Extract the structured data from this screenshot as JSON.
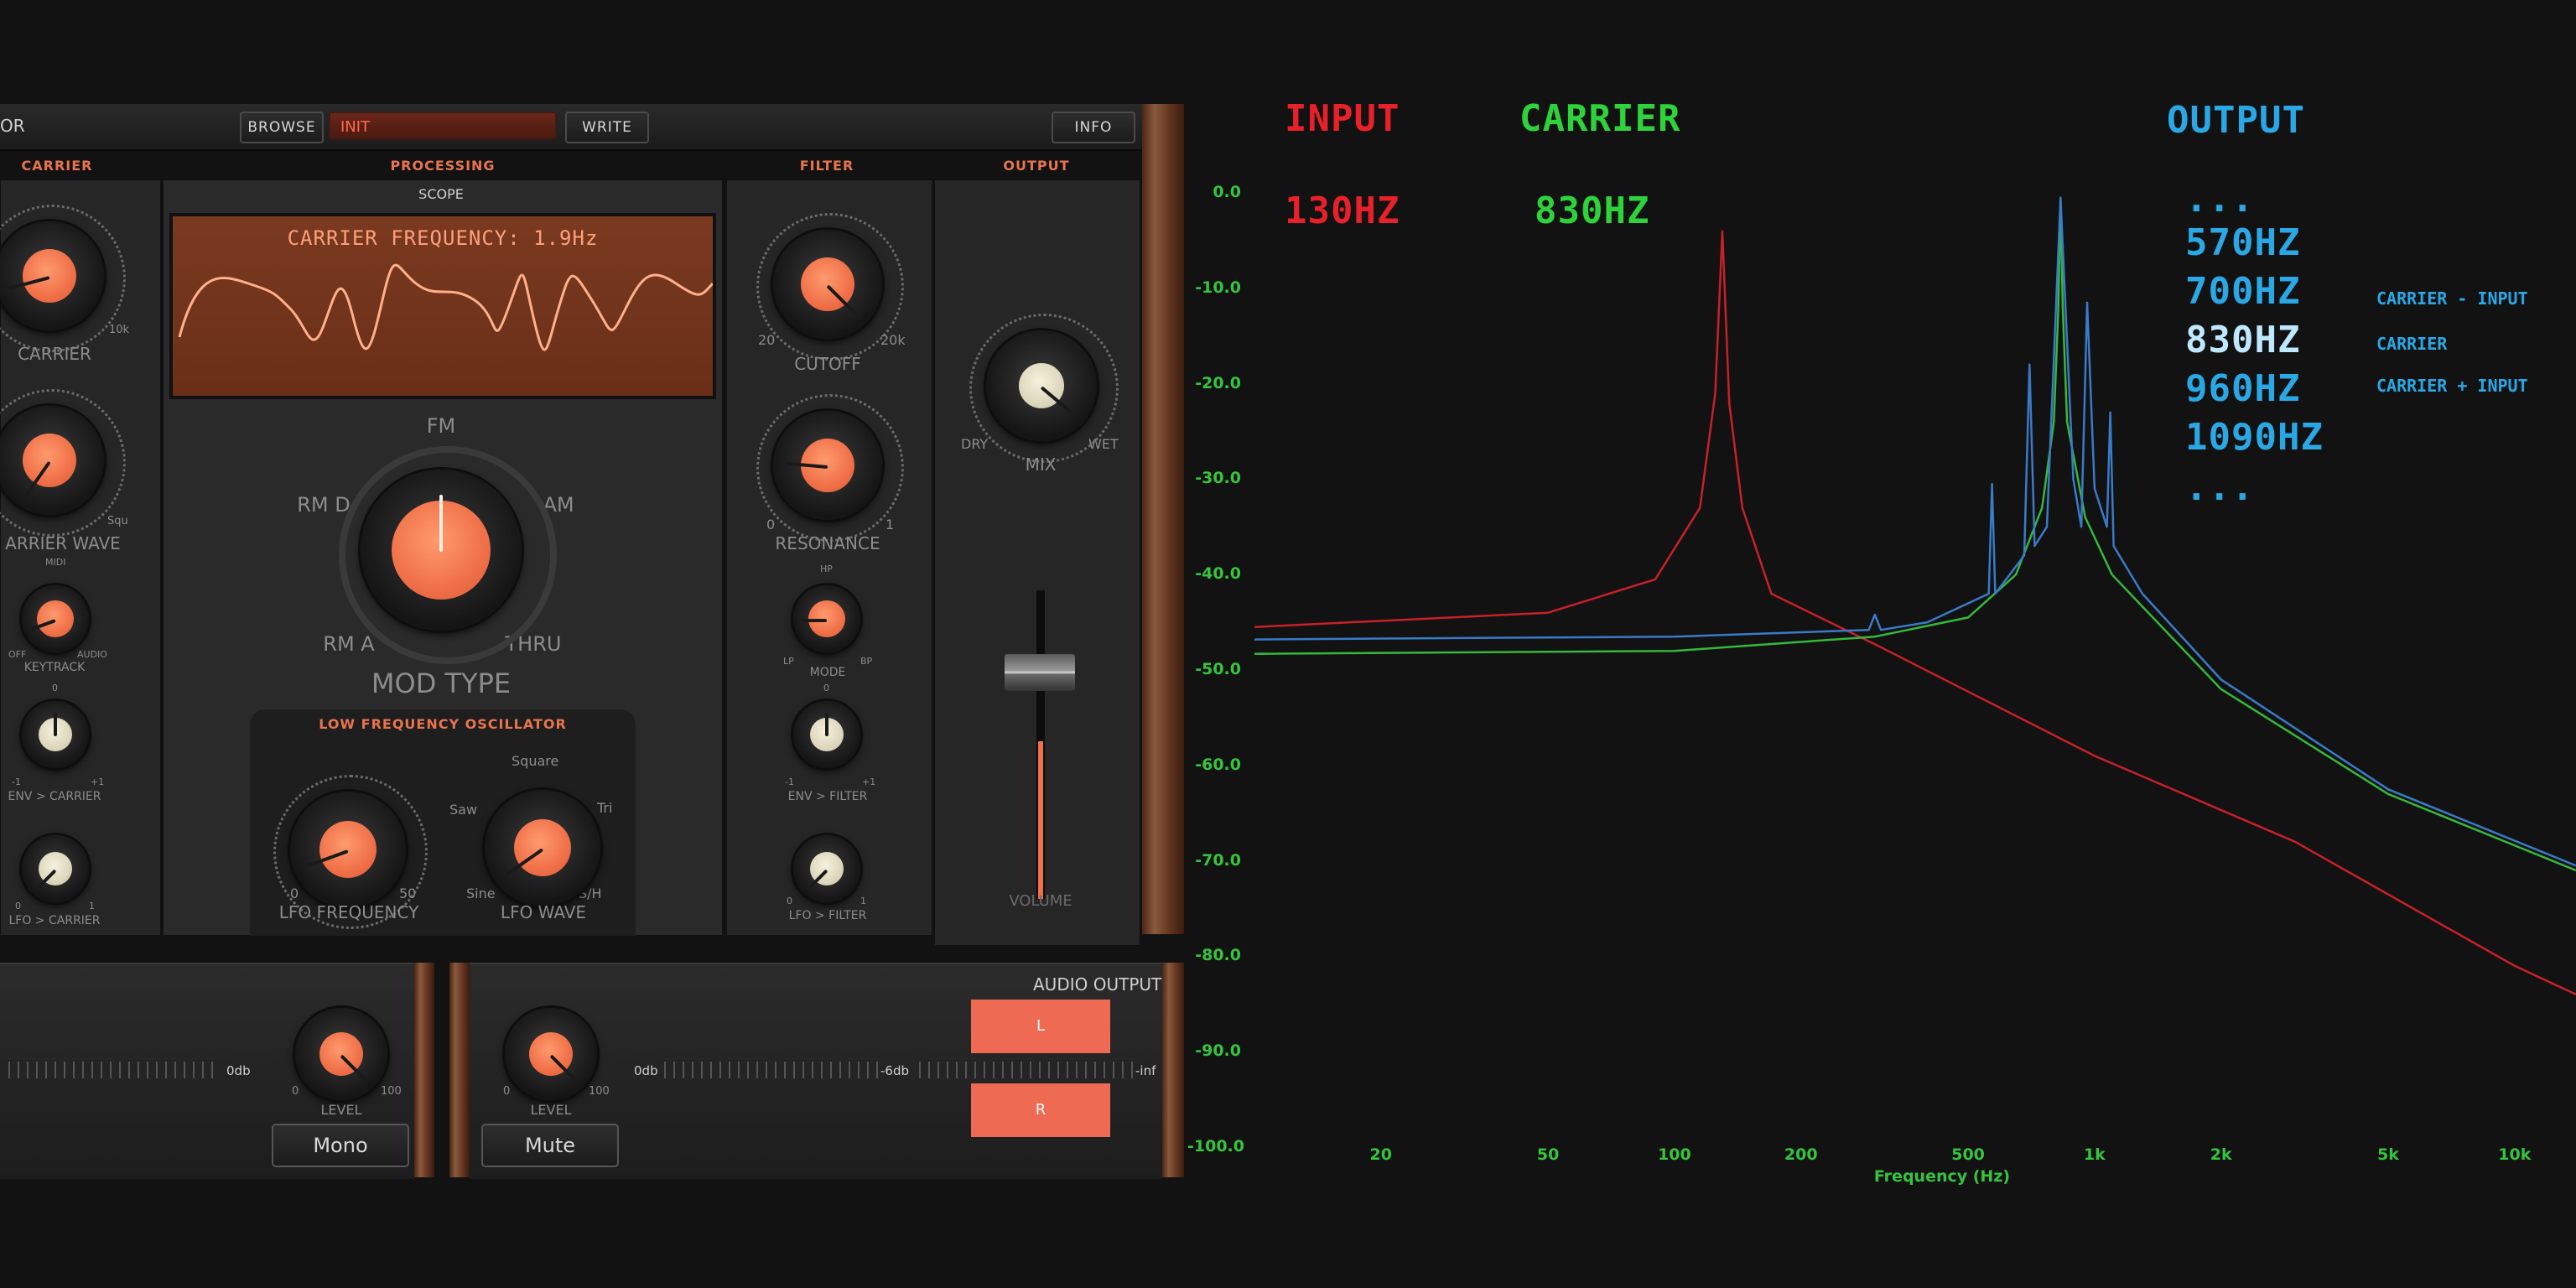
{
  "toolbar": {
    "title_fragment": "OR",
    "browse": "BROWSE",
    "preset": "INIT",
    "write": "WRITE",
    "info": "INFO"
  },
  "sections": {
    "carrier": "CARRIER",
    "processing": "PROCESSING",
    "filter": "FILTER",
    "output": "OUTPUT",
    "scope": "SCOPE",
    "lfo": "LOW FREQUENCY OSCILLATOR"
  },
  "scope": {
    "text": "CARRIER FREQUENCY: 1.9Hz"
  },
  "carrier": {
    "carrier_label": "CARRIER",
    "carrier_max": "10k",
    "wave_label": "ARRIER WAVE",
    "wave_max": "Squ",
    "keytrack_label": "KEYTRACK",
    "keytrack_midi": "MIDI",
    "keytrack_off": "OFF",
    "keytrack_audio": "AUDIO",
    "env_label": "ENV > CARRIER",
    "env_min": "-1",
    "env_zero": "0",
    "env_max": "+1",
    "lfo_label": "LFO > CARRIER",
    "lfo_min": "0",
    "lfo_max": "1"
  },
  "processing": {
    "modtype_label": "MOD TYPE",
    "fm": "FM",
    "rmd": "RM D",
    "am": "AM",
    "rma": "RM A",
    "thru": "THRU",
    "lfo_freq_label": "LFO FREQUENCY",
    "lfo_freq_min": "0",
    "lfo_freq_max": "50",
    "lfo_wave_label": "LFO WAVE",
    "square": "Square",
    "saw": "Saw",
    "tri": "Tri",
    "sine": "Sine",
    "sh": "S/H"
  },
  "filter": {
    "cutoff_label": "CUTOFF",
    "cutoff_min": "20",
    "cutoff_max": "20k",
    "res_label": "RESONANCE",
    "res_min": "0",
    "res_max": "1",
    "mode_label": "MODE",
    "hp": "HP",
    "lp": "LP",
    "bp": "BP",
    "env_label": "ENV > FILTER",
    "env_min": "-1",
    "env_zero": "0",
    "env_max": "+1",
    "lfo_label": "LFO > FILTER",
    "lfo_min": "0",
    "lfo_max": "1"
  },
  "output": {
    "mix_label": "MIX",
    "dry": "DRY",
    "wet": "WET",
    "volume_label": "VOLUME"
  },
  "bottom": {
    "left_db": "0db",
    "left_level_label": "LEVEL",
    "left_level_min": "0",
    "left_level_max": "100",
    "mono": "Mono",
    "right_level_label": "LEVEL",
    "right_level_min": "0",
    "right_level_max": "100",
    "mute": "Mute",
    "meter_0db": "0db",
    "meter_6db": "-6db",
    "meter_inf": "-inf",
    "audio_output": "AUDIO OUTPUT",
    "ch_l": "L",
    "ch_r": "R"
  },
  "annotations": {
    "input": "INPUT",
    "input_freq": "130HZ",
    "carrier": "CARRIER",
    "carrier_freq": "830HZ",
    "output": "OUTPUT",
    "list": [
      "...",
      "570HZ",
      "700HZ",
      "830HZ",
      "960HZ",
      "1090HZ",
      "..."
    ],
    "notes": [
      "CARRIER - INPUT",
      "CARRIER",
      "CARRIER + INPUT"
    ],
    "colors": {
      "input": "#e8202a",
      "carrier": "#2ed23a",
      "output": "#2aa8e6",
      "highlight": "#bfe8ff"
    }
  },
  "chart_data": {
    "type": "line",
    "title": "",
    "xlabel": "Frequency (Hz)",
    "ylabel": "",
    "x_scale": "log",
    "xlim": [
      10,
      14000
    ],
    "ylim": [
      -100,
      0
    ],
    "x_ticks": [
      20,
      50,
      100,
      200,
      500,
      1000,
      2000,
      5000,
      10000
    ],
    "x_tick_labels": [
      "20",
      "50",
      "100",
      "200",
      "500",
      "1k",
      "2k",
      "5k",
      "10k"
    ],
    "y_ticks": [
      0,
      -10,
      -20,
      -30,
      -40,
      -50,
      -60,
      -70,
      -80,
      -90,
      -100
    ],
    "y_tick_labels": [
      "0.0",
      "-10.0",
      "-20.0",
      "-30.0",
      "-40.0",
      "-50.0",
      "-60.0",
      "-70.0",
      "-80.0",
      "-90.0",
      "-100.0"
    ],
    "series": [
      {
        "name": "INPUT",
        "color": "#c8202a",
        "x": [
          10,
          50,
          90,
          115,
          125,
          130,
          135,
          145,
          170,
          300,
          1000,
          3000,
          10000,
          14000
        ],
        "y": [
          -45.5,
          -44,
          -40.5,
          -33,
          -21,
          -4,
          -22,
          -33,
          -42,
          -47.3,
          -59,
          -68,
          -81,
          -84
        ]
      },
      {
        "name": "CARRIER",
        "color": "#36b83c",
        "x": [
          10,
          100,
          300,
          500,
          650,
          750,
          800,
          820,
          830,
          840,
          860,
          950,
          1100,
          2000,
          5000,
          14000
        ],
        "y": [
          -48.3,
          -48,
          -46.5,
          -44.5,
          -40,
          -33,
          -24,
          -12,
          -0.5,
          -12,
          -24,
          -34,
          -40,
          -52,
          -63,
          -71
        ]
      },
      {
        "name": "OUTPUT",
        "color": "#3a7ac8",
        "x": [
          10,
          100,
          290,
          300,
          310,
          400,
          560,
          570,
          580,
          680,
          700,
          720,
          770,
          830,
          890,
          930,
          960,
          1000,
          1070,
          1090,
          1110,
          1300,
          2000,
          5000,
          14000
        ],
        "y": [
          -46.8,
          -46.5,
          -45.8,
          -44.2,
          -45.8,
          -45,
          -42,
          -30.5,
          -42,
          -38,
          -18,
          -37,
          -35,
          -0.5,
          -30,
          -35,
          -11.5,
          -31,
          -35,
          -23,
          -37,
          -42,
          -51,
          -62.5,
          -70.5
        ]
      }
    ]
  }
}
